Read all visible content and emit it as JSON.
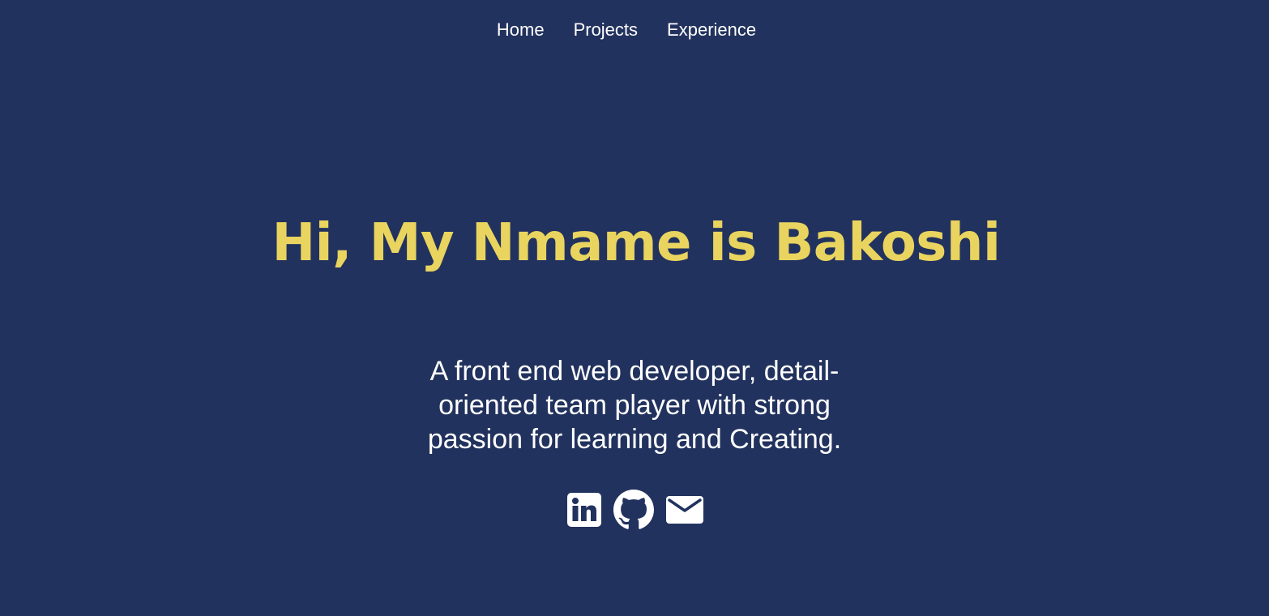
{
  "nav": {
    "items": [
      {
        "label": "Home"
      },
      {
        "label": "Projects"
      },
      {
        "label": "Experience"
      }
    ]
  },
  "hero": {
    "title": "Hi, My Nmame is Bakoshi",
    "subtitle": "A front end web developer, detail-oriented team player with strong passion for learning and Creating."
  },
  "social": {
    "icons": [
      "linkedin-icon",
      "github-icon",
      "email-icon"
    ]
  },
  "colors": {
    "background": "#22325e",
    "title": "#e9d45f",
    "text": "#ffffff"
  }
}
